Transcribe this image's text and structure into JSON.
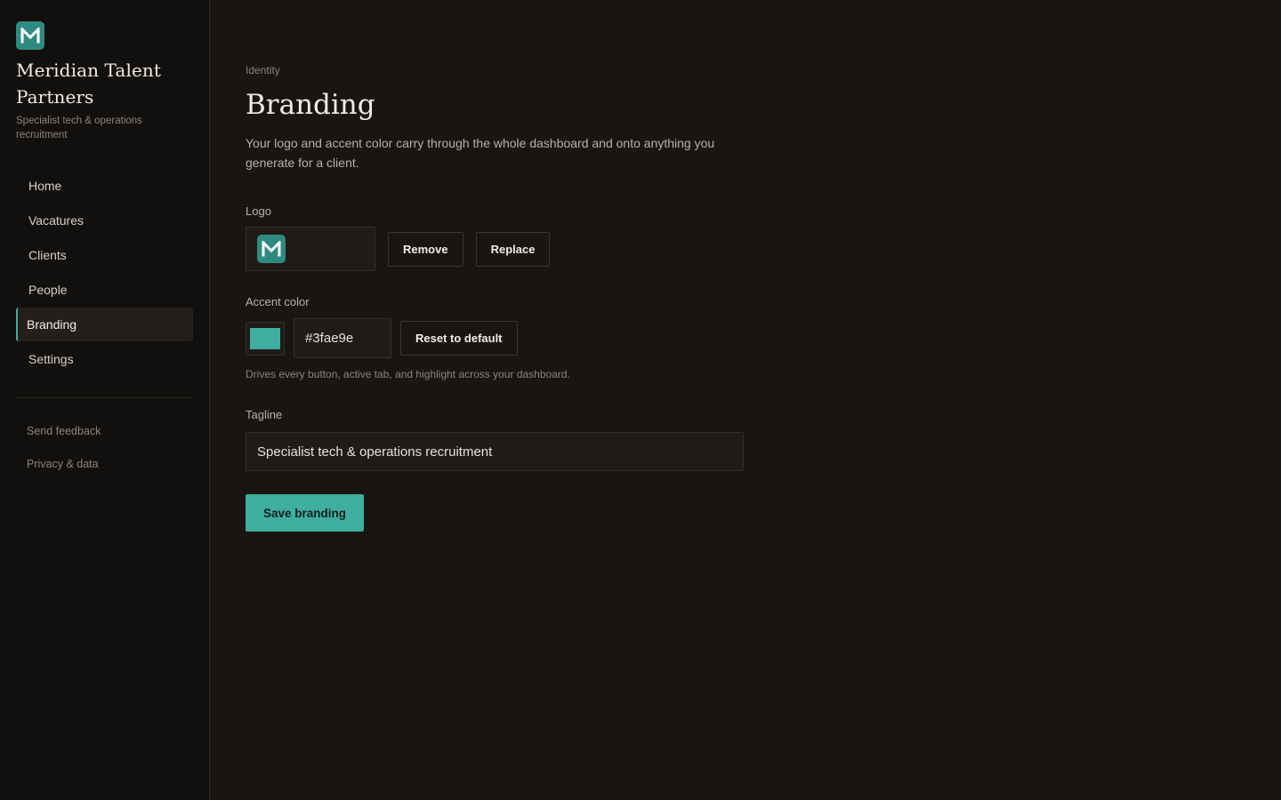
{
  "brand": {
    "logo_icon": "m-monogram-icon",
    "name": "Meridian Talent Partners",
    "tagline": "Specialist tech & operations recruitment"
  },
  "sidebar": {
    "items": [
      {
        "label": "Home"
      },
      {
        "label": "Vacatures"
      },
      {
        "label": "Clients"
      },
      {
        "label": "People"
      },
      {
        "label": "Branding",
        "active": true
      },
      {
        "label": "Settings"
      }
    ],
    "secondary": [
      {
        "label": "Send feedback"
      },
      {
        "label": "Privacy & data"
      }
    ]
  },
  "page": {
    "eyebrow": "Identity",
    "title": "Branding",
    "description": "Your logo and accent color carry through the whole dashboard and onto anything you generate for a client."
  },
  "logo_field": {
    "label": "Logo",
    "remove_label": "Remove",
    "replace_label": "Replace"
  },
  "accent_field": {
    "label": "Accent color",
    "value": "#3fae9e",
    "reset_label": "Reset to default",
    "helper": "Drives every button, active tab, and highlight across your dashboard."
  },
  "tagline_field": {
    "label": "Tagline",
    "value": "Specialist tech & operations recruitment"
  },
  "save_label": "Save branding",
  "colors": {
    "accent": "#3fae9e",
    "logo_bg": "#2f8a7f",
    "background": "#181513",
    "sidebar_bg": "#12100e"
  }
}
